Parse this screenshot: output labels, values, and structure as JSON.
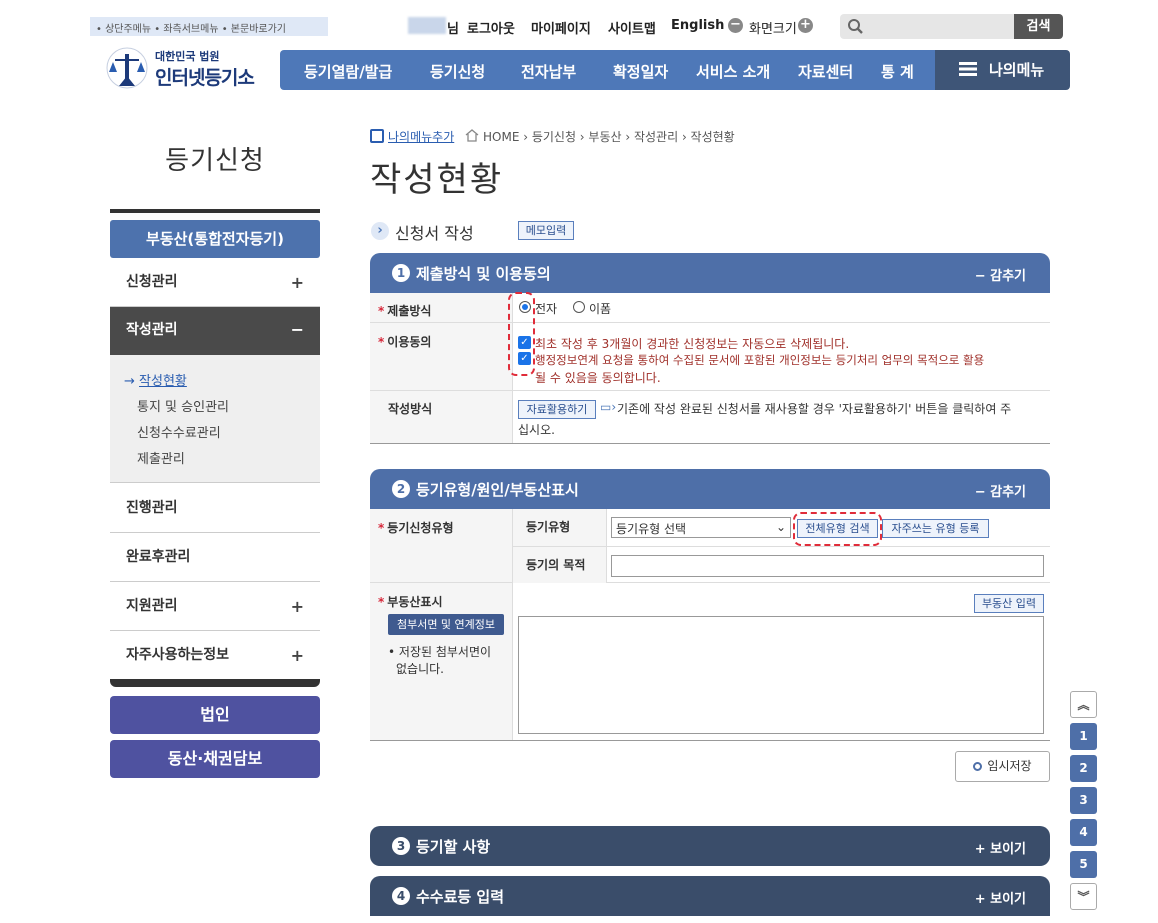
{
  "top": {
    "skip_links": "• 상단주메뉴 • 좌측서브메뉴 • 본문바로가기",
    "user_suffix": "님",
    "links": [
      "로그아웃",
      "마이페이지",
      "사이트맵",
      "English"
    ],
    "screen_size": "화면크기",
    "search_placeholder": "",
    "search_button": "검색"
  },
  "logo": {
    "line1": "대한민국 법원",
    "line2": "인터넷등기소"
  },
  "gnb": {
    "items": [
      "등기열람/발급",
      "등기신청",
      "전자납부",
      "확정일자",
      "서비스 소개",
      "자료센터",
      "통 계"
    ],
    "my_menu": "나의메뉴"
  },
  "lnb": {
    "title": "등기신청",
    "head": "부동산(통합전자등기)",
    "items": [
      "신청관리",
      "작성관리",
      "진행관리",
      "완료후관리",
      "지원관리",
      "자주사용하는정보"
    ],
    "sub_items": [
      "작성현황",
      "통지 및 승인관리",
      "신청수수료관리",
      "제출관리"
    ],
    "buttons": [
      "법인",
      "동산·채권담보"
    ]
  },
  "breadcrumb": {
    "fav_add": "나의메뉴추가",
    "path": "HOME › 등기신청 › 부동산 › 작성관리 › 작성현황"
  },
  "page_title": "작성현황",
  "section": {
    "title": "신청서 작성",
    "memo_button": "메모입력"
  },
  "panel1": {
    "num": "1",
    "title": "제출방식 및 이용동의",
    "toggle": "감추기",
    "submit_label": "제출방식",
    "radio_electronic": "전자",
    "radio_paper": "이폼",
    "consent_label": "이용동의",
    "consent1": "최초 작성 후 3개월이 경과한 신청정보는 자동으로 삭제됩니다.",
    "consent2a": "행정정보연계 요청을 통하여 수집된 문서에 포함된 개인정보는 등기처리 업무의 목적으로 활용",
    "consent2b": "될 수 있음을 동의합니다.",
    "method_label": "작성방식",
    "method_button": "자료활용하기",
    "method_desc_a": "기존에 작성 완료된 신청서를 재사용할 경우 '자료활용하기' 버튼을 클릭하여 주",
    "method_desc_b": "십시오."
  },
  "panel2": {
    "num": "2",
    "title": "등기유형/원인/부동산표시",
    "toggle": "감추기",
    "type_label": "등기신청유형",
    "sub_type_label": "등기유형",
    "select_value": "등기유형 선택",
    "search_all": "전체유형 검색",
    "register_fav": "자주쓰는 유형 등록",
    "purpose_label": "등기의 목적",
    "property_label": "부동산표시",
    "attach_button": "첨부서면 및 연계정보",
    "no_attach_a": "저장된 첨부서면이",
    "no_attach_b": "없습니다.",
    "property_input_button": "부동산 입력"
  },
  "temp_save": "임시저장",
  "panel3": {
    "num": "3",
    "title": "등기할 사항",
    "toggle": "보이기"
  },
  "panel4": {
    "num": "4",
    "title": "수수료등 입력",
    "toggle": "보이기"
  },
  "quick": [
    "1",
    "2",
    "3",
    "4",
    "5"
  ]
}
